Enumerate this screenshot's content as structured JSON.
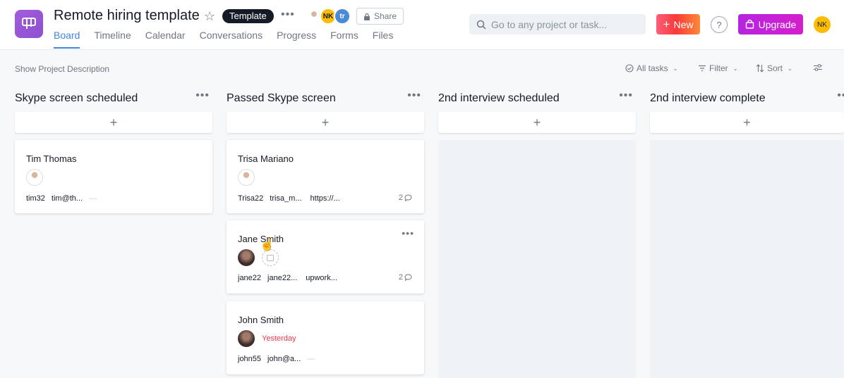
{
  "project": {
    "title": "Remote hiring template",
    "badge": "Template",
    "share_label": "Share"
  },
  "members": [
    {
      "initials": "",
      "color": "#6b6f75"
    },
    {
      "initials": "NK",
      "color": "#fcbd01"
    },
    {
      "initials": "tr",
      "color": "#4a8ad6"
    }
  ],
  "tabs": [
    "Board",
    "Timeline",
    "Calendar",
    "Conversations",
    "Progress",
    "Forms",
    "Files"
  ],
  "active_tab": "Board",
  "search": {
    "placeholder": "Go to any project or task..."
  },
  "header_buttons": {
    "new_label": "New",
    "help_label": "?",
    "upgrade_label": "Upgrade",
    "user_initials": "NK"
  },
  "toolbar": {
    "show_description": "Show Project Description",
    "all_tasks": "All tasks",
    "filter": "Filter",
    "sort": "Sort"
  },
  "columns": [
    {
      "title": "Skype screen scheduled",
      "cards": [
        {
          "name": "Tim Thomas",
          "fields": [
            "tim32",
            "tim@th...",
            "—"
          ],
          "comments": ""
        }
      ]
    },
    {
      "title": "Passed Skype screen",
      "cards": [
        {
          "name": "Trisa Mariano",
          "fields": [
            "Trisa22",
            "trisa_m...",
            "https://..."
          ],
          "comments": "2"
        },
        {
          "name": "Jane Smith",
          "fields": [
            "jane22",
            "jane22...",
            "upwork..."
          ],
          "comments": "2"
        },
        {
          "name": "John Smith",
          "due": "Yesterday",
          "fields": [
            "john55",
            "john@a...",
            "—"
          ],
          "comments": ""
        }
      ]
    },
    {
      "title": "2nd interview scheduled",
      "cards": []
    },
    {
      "title": "2nd interview complete",
      "cards": []
    }
  ],
  "colors": {
    "accent": "#4186e0",
    "due_red": "#e8384f",
    "project_icon": "#a25ddc"
  },
  "icons": [
    "board-icon",
    "star-icon",
    "lock-icon",
    "search-icon",
    "plus-icon",
    "shopping-bag-icon",
    "check-circle-icon",
    "filter-icon",
    "sort-icon",
    "customize-icon",
    "comment-icon",
    "hand-cursor-icon"
  ]
}
